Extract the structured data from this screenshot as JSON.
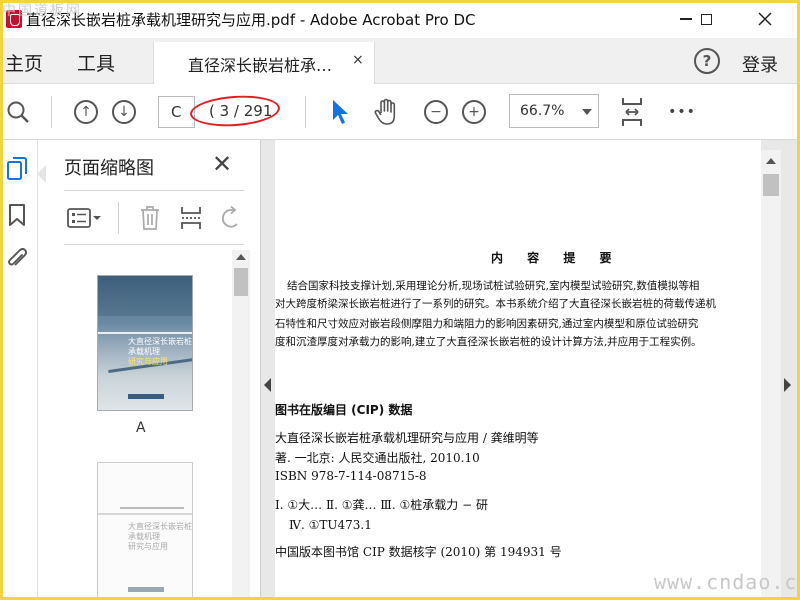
{
  "window": {
    "title": "直径深长嵌岩桩承载机理研究与应用.pdf - Adobe Acrobat Pro DC",
    "minimize_icon": "minimize-icon",
    "maximize_icon": "maximize-icon",
    "close_icon": "close-icon"
  },
  "watermarks": {
    "top_left": "中国道板网",
    "bottom_right": "www.cndao.com"
  },
  "tabbar": {
    "home_label": "主页",
    "tools_label": "工具",
    "doc_tab_label": "直径深长嵌岩桩承…",
    "doc_tab_close": "×",
    "help_glyph": "?",
    "login_label": "登录"
  },
  "toolbar": {
    "page_input_value": "C",
    "page_count": "( 3 / 291",
    "zoom_value": "66.7%",
    "more_glyph": "•••"
  },
  "panel": {
    "title": "页面缩略图",
    "close_glyph": "✕",
    "thumbs": [
      {
        "label": "A",
        "cover_line1": "大直径深长嵌岩桩",
        "cover_line2": "承载机理",
        "cover_line3": "研究与应用"
      },
      {
        "label": "",
        "cover_line1": "大直径深长嵌岩桩",
        "cover_line2": "承载机理",
        "cover_line3": "研究与应用"
      }
    ]
  },
  "page": {
    "heading": "内 容 提 要",
    "body": [
      "结合国家科技支撑计划,采用理论分析,现场试桩试验研究,室内模型试验研究,数值模拟等相",
      "对大跨度桥梁深长嵌岩桩进行了一系列的研究。本书系统介绍了大直径深长嵌岩桩的荷载传递机",
      "石特性和尺寸效应对嵌岩段侧摩阻力和端阻力的影响因素研究,通过室内模型和原位试验研究",
      "度和沉渣厚度对承载力的影响,建立了大直径深长嵌岩桩的设计计算方法,并应用于工程实例。"
    ],
    "cip": [
      "图书在版编目 (CIP) 数据",
      "大直径深长嵌岩桩承载机理研究与应用 / 龚维明等",
      "著. 一北京: 人民交通出版社, 2010.10",
      "ISBN 978-7-114-08715-8",
      "Ⅰ. ①大…   Ⅱ. ①龚…   Ⅲ. ①桩承载力 − 研",
      "Ⅳ. ①TU473.1",
      "中国版本图书馆 CIP 数据核字 (2010) 第 194931 号"
    ]
  }
}
